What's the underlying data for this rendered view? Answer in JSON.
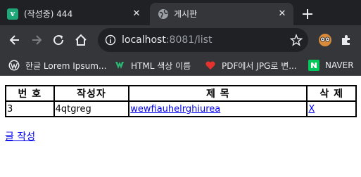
{
  "browser": {
    "tabs": [
      {
        "title": "(작성중) 444",
        "favicon": "vue-icon",
        "active": false
      },
      {
        "title": "게시판",
        "favicon": "globe-icon",
        "active": true
      }
    ],
    "url": {
      "host": "localhost",
      "rest": ":8081/list"
    },
    "bookmarks": [
      {
        "label": "한글 Lorem Ipsum...",
        "icon": "wordpress-icon"
      },
      {
        "label": "HTML 색상 이름",
        "icon": "leaf-icon"
      },
      {
        "label": "PDF에서 JPG로 변...",
        "icon": "heart-icon"
      },
      {
        "label": "NAVER",
        "icon": "naver-icon"
      }
    ],
    "colors": {
      "chrome_dark": "#202124",
      "chrome": "#35363a",
      "link": "#0000ee"
    }
  },
  "board": {
    "headers": {
      "num": "번 호",
      "author": "작성자",
      "title": "제 목",
      "delete": "삭 제"
    },
    "rows": [
      {
        "num": "3",
        "author": "4qtgreg",
        "title": "wewfiauhelrghiurea",
        "delete": "X"
      }
    ]
  },
  "write_link": "글 작성"
}
